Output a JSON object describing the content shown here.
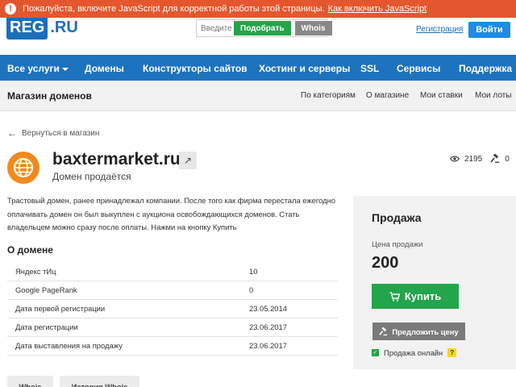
{
  "js_warning": {
    "text": "Пожалуйста, включите JavaScript для корректной работы этой страницы.",
    "link": "Как включить JavaScript"
  },
  "header": {
    "logo_main": "REG",
    "logo_suffix": ".RU",
    "search_placeholder": "Введите",
    "pick_label": "Подобрать",
    "whois_label": "Whois",
    "register_link": "Регистрация",
    "login_label": "Войти"
  },
  "nav": {
    "items": [
      {
        "label": "Все услуги"
      },
      {
        "label": "Домены"
      },
      {
        "label": "Конструкторы сайтов"
      },
      {
        "label": "Хостинг и серверы"
      },
      {
        "label": "SSL"
      },
      {
        "label": "Сервисы"
      },
      {
        "label": "Поддержка"
      }
    ]
  },
  "subbar": {
    "title": "Магазин доменов",
    "links": [
      {
        "label": "По категориям"
      },
      {
        "label": "О магазине"
      },
      {
        "label": "Мои ставки"
      },
      {
        "label": "Мои лоты"
      }
    ]
  },
  "back_link": "Вернуться в магазин",
  "domain": {
    "name": "baxtermarket.ru",
    "subtitle": "Домен продаётся",
    "views": "2195",
    "bids": "0",
    "description": "Трастовый домен, ранее принадлежал компании. После того как фирма перестала ежегодно оплачивать домен он был выкуплен с аукциона освобождающихся доменов. Стать владельцем можно сразу после оплаты. Нажми на кнопку Купить"
  },
  "about": {
    "title": "О домене",
    "rows": [
      {
        "label": "Яндекс тИц",
        "value": "10"
      },
      {
        "label": "Google PageRank",
        "value": "0"
      },
      {
        "label": "Дата первой регистрации",
        "value": "23.05.2014"
      },
      {
        "label": "Дата регистрации",
        "value": "23.06.2017"
      },
      {
        "label": "Дата выставления на продажу",
        "value": "23.06.2017"
      }
    ]
  },
  "sale": {
    "title": "Продажа",
    "price_label": "Цена продажи",
    "price": "200",
    "buy_label": "Купить",
    "offer_label": "Предложить цену",
    "online_label": "Продажа онлайн",
    "help_mark": "?"
  },
  "bottom_buttons": [
    {
      "label": "Whois"
    },
    {
      "label": "История Whois"
    }
  ],
  "colors": {
    "brand_blue": "#1e73be",
    "green": "#23a54b",
    "warning": "#e4572e",
    "domain_icon": "#f08a1c"
  }
}
